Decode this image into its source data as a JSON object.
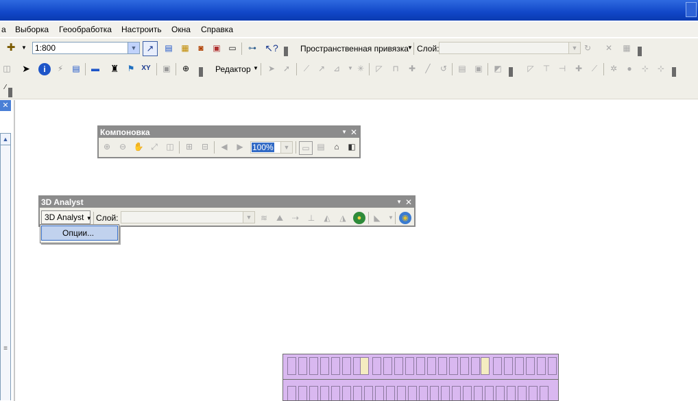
{
  "menu": [
    "а",
    "Выборка",
    "Геообработка",
    "Настроить",
    "Окна",
    "Справка"
  ],
  "toolbar1": {
    "scale_value": "1:800",
    "snapping_label": "Пространственная привязка",
    "layer_label": "Слой:",
    "layer_value": ""
  },
  "toolbar2": {
    "editor_label": "Редактор"
  },
  "layout_window": {
    "title": "Компоновка",
    "zoom_value": "100%"
  },
  "analyst_window": {
    "title": "3D Analyst",
    "menu_button": "3D Analyst",
    "layer_label": "Слой:",
    "layer_value": ""
  },
  "analyst_popup": {
    "items": [
      "Опции..."
    ]
  }
}
